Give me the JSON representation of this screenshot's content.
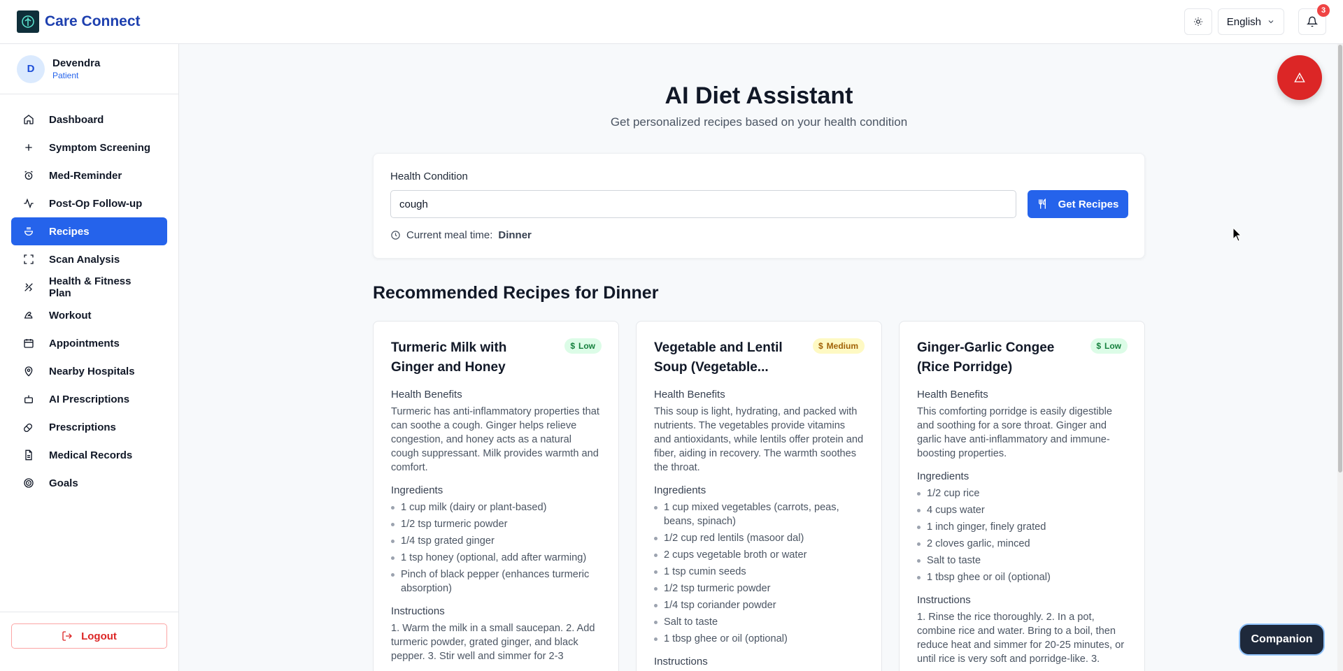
{
  "app": {
    "title": "Care Connect",
    "language": "English",
    "notification_count": "3",
    "theme_icon": "sun-icon"
  },
  "user": {
    "initial": "D",
    "name": "Devendra",
    "role": "Patient"
  },
  "sidebar": {
    "items": [
      {
        "label": "Dashboard",
        "icon": "home-icon"
      },
      {
        "label": "Symptom Screening",
        "icon": "plus-icon"
      },
      {
        "label": "Med-Reminder",
        "icon": "alarm-clock-icon"
      },
      {
        "label": "Post-Op Follow-up",
        "icon": "activity-icon"
      },
      {
        "label": "Recipes",
        "icon": "cooking-pot-icon",
        "active": true
      },
      {
        "label": "Scan Analysis",
        "icon": "scan-icon"
      },
      {
        "label": "Health & Fitness Plan",
        "icon": "fitness-icon"
      },
      {
        "label": "Workout",
        "icon": "bicep-icon"
      },
      {
        "label": "Appointments",
        "icon": "calendar-icon"
      },
      {
        "label": "Nearby Hospitals",
        "icon": "map-pin-icon"
      },
      {
        "label": "AI Prescriptions",
        "icon": "bot-icon"
      },
      {
        "label": "Prescriptions",
        "icon": "pill-icon"
      },
      {
        "label": "Medical Records",
        "icon": "file-text-icon"
      },
      {
        "label": "Goals",
        "icon": "target-icon"
      }
    ],
    "logout_label": "Logout"
  },
  "page": {
    "title": "AI Diet Assistant",
    "subtitle": "Get personalized recipes based on your health condition"
  },
  "form": {
    "label": "Health Condition",
    "value": "cough",
    "button_label": "Get Recipes",
    "meal_prefix": "Current meal time:",
    "meal_time": "Dinner"
  },
  "recipes": {
    "section_title": "Recommended Recipes for Dinner",
    "benefits_heading": "Health Benefits",
    "ingredients_heading": "Ingredients",
    "instructions_heading": "Instructions",
    "items": [
      {
        "title": "Turmeric Milk with Ginger and Honey",
        "cost": "Low",
        "benefits": "Turmeric has anti-inflammatory properties that can soothe a cough. Ginger helps relieve congestion, and honey acts as a natural cough suppressant. Milk provides warmth and comfort.",
        "ingredients": [
          "1 cup milk (dairy or plant-based)",
          "1/2 tsp turmeric powder",
          "1/4 tsp grated ginger",
          "1 tsp honey (optional, add after warming)",
          "Pinch of black pepper (enhances turmeric absorption)"
        ],
        "instructions": "1. Warm the milk in a small saucepan. 2. Add turmeric powder, grated ginger, and black pepper. 3. Stir well and simmer for 2-3"
      },
      {
        "title": "Vegetable and Lentil Soup (Vegetable...",
        "cost": "Medium",
        "benefits": "This soup is light, hydrating, and packed with nutrients. The vegetables provide vitamins and antioxidants, while lentils offer protein and fiber, aiding in recovery. The warmth soothes the throat.",
        "ingredients": [
          "1 cup mixed vegetables (carrots, peas, beans, spinach)",
          "1/2 cup red lentils (masoor dal)",
          "2 cups vegetable broth or water",
          "1 tsp cumin seeds",
          "1/2 tsp turmeric powder",
          "1/4 tsp coriander powder",
          "Salt to taste",
          "1 tbsp ghee or oil (optional)"
        ],
        "instructions": ""
      },
      {
        "title": "Ginger-Garlic Congee (Rice Porridge)",
        "cost": "Low",
        "benefits": "This comforting porridge is easily digestible and soothing for a sore throat. Ginger and garlic have anti-inflammatory and immune-boosting properties.",
        "ingredients": [
          "1/2 cup rice",
          "4 cups water",
          "1 inch ginger, finely grated",
          "2 cloves garlic, minced",
          "Salt to taste",
          "1 tbsp ghee or oil (optional)"
        ],
        "instructions": "1. Rinse the rice thoroughly. 2. In a pot, combine rice and water. Bring to a boil, then reduce heat and simmer for 20-25 minutes, or until rice is very soft and porridge-like. 3."
      }
    ]
  },
  "floating": {
    "sos_icon": "alert-triangle-icon",
    "companion_label": "Companion"
  }
}
